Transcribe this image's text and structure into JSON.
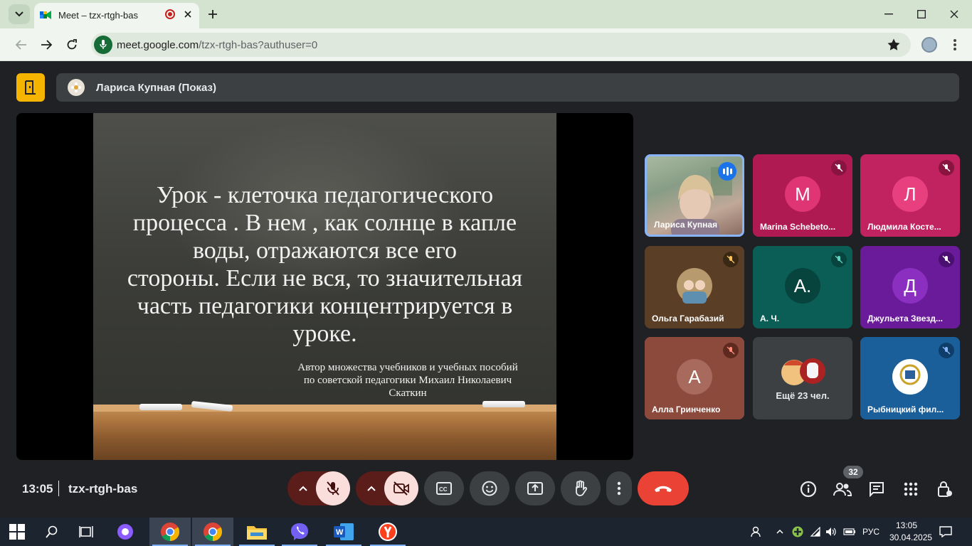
{
  "browser": {
    "tab_title": "Meet – tzx-rtgh-bas",
    "url_host": "meet.google.com",
    "url_path": "/tzx-rtgh-bas?authuser=0"
  },
  "meet": {
    "presenter": "Лариса Купная (Показ)",
    "slide": {
      "line1": "Урок - клеточка педагогического",
      "line2": "процесса . В нем , как солнце в капле",
      "line3": "воды, отражаются все его",
      "line4": "стороны.  Если не вся, то значительная",
      "line5": "часть педагогики концентрируется в",
      "line6": "уроке.",
      "author1": "Автор множества учебников и учебных пособий",
      "author2": "по советской педагогики  Михаил Николаевич",
      "author3": "Скаткин"
    },
    "participants": [
      {
        "name": "Лариса Купная",
        "initial": "",
        "color": "#8aa08a"
      },
      {
        "name": "Marina Schebeto...",
        "initial": "M",
        "color": "#d81b60"
      },
      {
        "name": "Людмила Косте...",
        "initial": "Л",
        "color": "#d81b60"
      },
      {
        "name": "Ольга Гарабазий",
        "initial": "",
        "color": "#6d4c2f"
      },
      {
        "name": "А. Ч.",
        "initial": "А.",
        "color": "#00695c"
      },
      {
        "name": "Джульета Звезд...",
        "initial": "Д",
        "color": "#7b1fa2"
      },
      {
        "name": "Алла Гринченко",
        "initial": "А",
        "color": "#8d4a3c"
      },
      {
        "name": "",
        "initial": "",
        "color": "#3c4043"
      },
      {
        "name": "Рыбницкий фил...",
        "initial": "",
        "color": "#1976d2"
      }
    ],
    "more_label": "Ещё 23 чел.",
    "time": "13:05",
    "meeting_code": "tzx-rtgh-bas",
    "people_count": "32",
    "accent_red": "#ea4335"
  },
  "taskbar": {
    "lang": "РУС",
    "time": "13:05",
    "date": "30.04.2025"
  }
}
